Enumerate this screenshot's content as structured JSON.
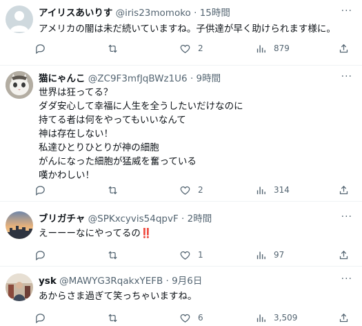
{
  "tweets": [
    {
      "name": "アイリスあいりす",
      "handle": "@iris23momoko",
      "time": "15時間",
      "body": "アメリカの闇は未だ続いていますね。子供達が早く助けられます様に。",
      "replies": "",
      "retweets": "",
      "likes": "2",
      "views": "879",
      "avatar": "default-avatar"
    },
    {
      "name": "猫にゃんこ",
      "handle": "@ZC9F3mfJqBWz1U6",
      "time": "9時間",
      "body": "世界は狂ってる？\nダダ安心して幸福に人生を全うしたいだけなのに\n持てる者は何をやってもいいなんて\n神は存在しない！\n私達ひとりひとりが神の細胞\nがんになった細胞が猛威を奮っている\n嘆かわしい！",
      "replies": "",
      "retweets": "",
      "likes": "2",
      "views": "314",
      "avatar": "cat-avatar"
    },
    {
      "name": "ブリガチャ",
      "handle": "@SPKxcyvis54qpvF",
      "time": "2時間",
      "body": "えーーーなにやってるの",
      "body_emoji": "‼️",
      "replies": "",
      "retweets": "",
      "likes": "1",
      "views": "97",
      "avatar": "sunset-city-avatar"
    },
    {
      "name": "ysk",
      "handle": "@MAWYG3RqakxYEFB",
      "time": "9月6日",
      "body": "あからさま過ぎて笑っちゃいますね。",
      "replies": "",
      "retweets": "",
      "likes": "6",
      "views": "3,509",
      "avatar": "person-photo-avatar"
    }
  ],
  "separator": "·",
  "more_glyph": "···",
  "colors": {
    "text": "#0f1419",
    "secondary": "#536471",
    "divider": "#eff3f4",
    "bang": "#d0021b"
  }
}
